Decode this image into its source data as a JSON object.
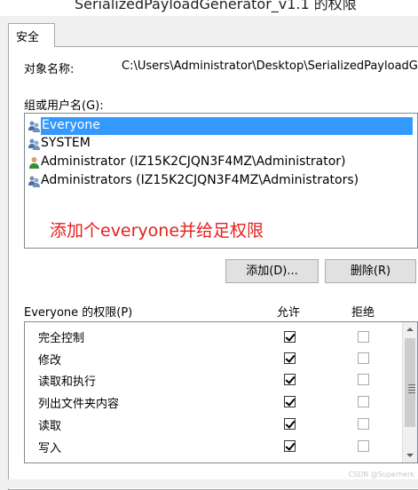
{
  "window": {
    "title": "SerializedPayloadGenerator_v1.1 的权限"
  },
  "tabs": [
    {
      "label": "安全"
    }
  ],
  "object": {
    "label": "对象名称:",
    "value": "C:\\Users\\Administrator\\Desktop\\SerializedPayloadG"
  },
  "groups": {
    "label": "组或用户名(G):",
    "items": [
      {
        "name": "Everyone",
        "selected": true,
        "icon": "users-icon"
      },
      {
        "name": "SYSTEM",
        "selected": false,
        "icon": "users-icon"
      },
      {
        "name": "Administrator (IZ15K2CJQN3F4MZ\\Administrator)",
        "selected": false,
        "icon": "user-icon"
      },
      {
        "name": "Administrators (IZ15K2CJQN3F4MZ\\Administrators)",
        "selected": false,
        "icon": "users-icon"
      }
    ]
  },
  "annotation": "添加个everyone并给足权限",
  "buttons": {
    "add": "添加(D)...",
    "remove": "删除(R)"
  },
  "permissions": {
    "label": "Everyone 的权限(P)",
    "allow_header": "允许",
    "deny_header": "拒绝",
    "rows": [
      {
        "name": "完全控制",
        "allow": true,
        "deny": false
      },
      {
        "name": "修改",
        "allow": true,
        "deny": false
      },
      {
        "name": "读取和执行",
        "allow": true,
        "deny": false
      },
      {
        "name": "列出文件夹内容",
        "allow": true,
        "deny": false
      },
      {
        "name": "读取",
        "allow": true,
        "deny": false
      },
      {
        "name": "写入",
        "allow": true,
        "deny": false
      }
    ]
  },
  "watermark": "CSDN @Superherk"
}
